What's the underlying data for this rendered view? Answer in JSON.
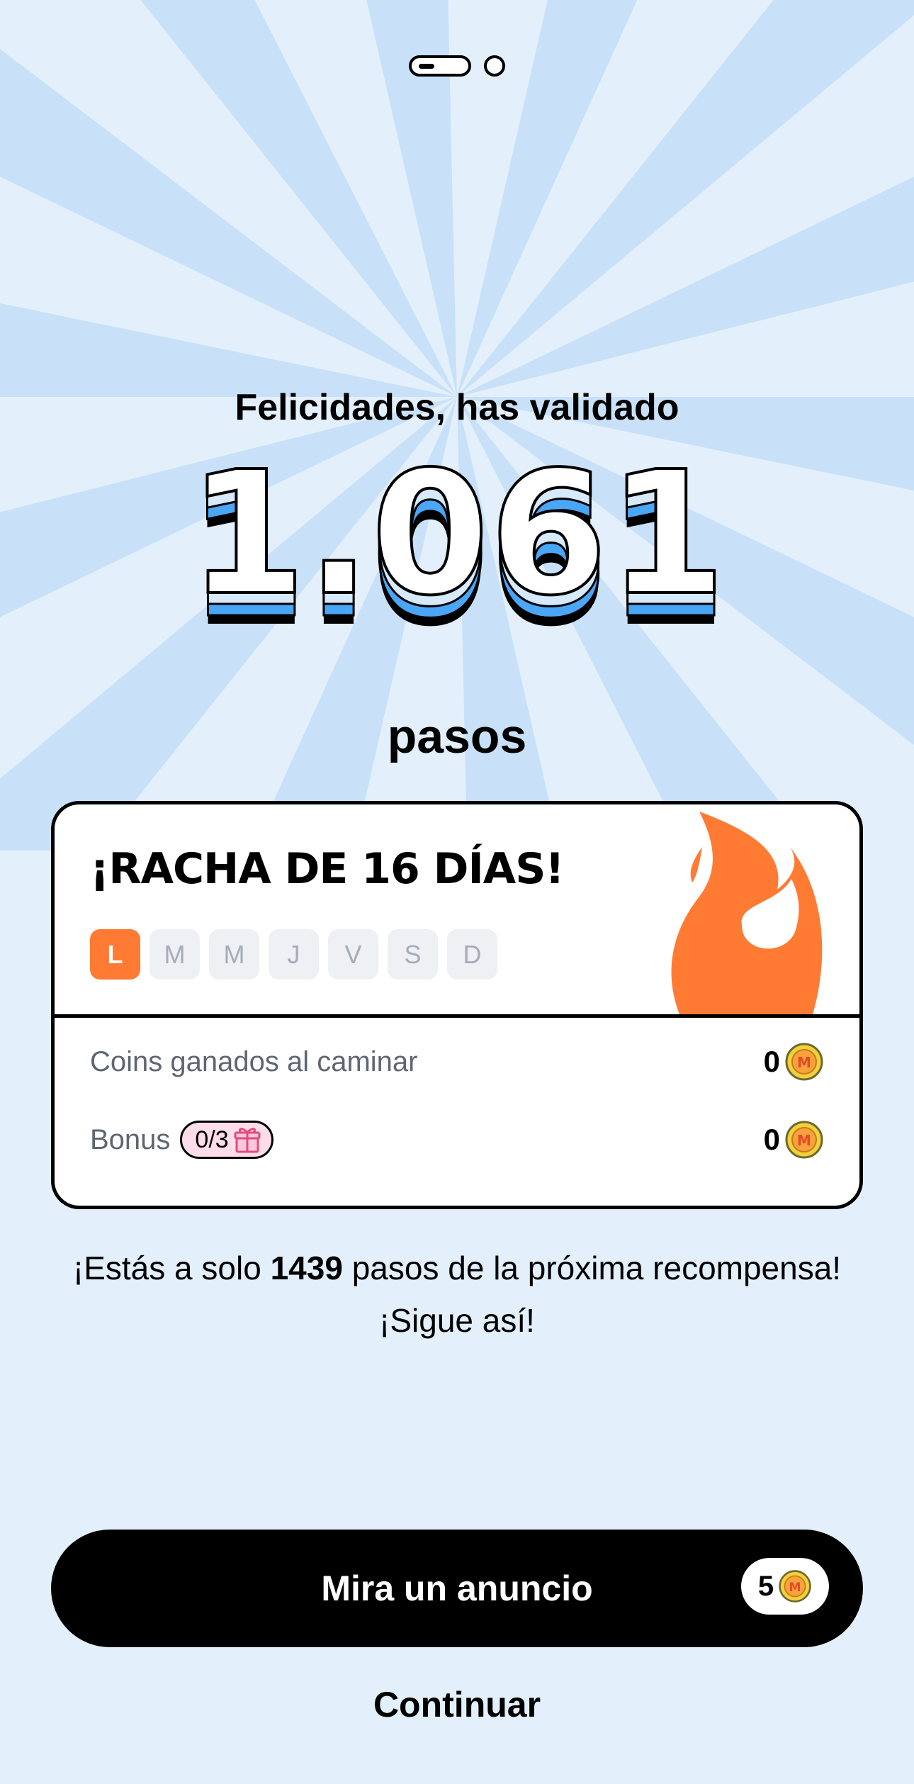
{
  "colors": {
    "background": "#e3f0fc",
    "rays": "#c9e1f8",
    "accent_orange": "#ff7a33",
    "accent_blue": "#4aa6f6",
    "coin_gold": "#f3cf3b",
    "badge_pink": "#ffdcea"
  },
  "pager": {
    "pages": 2,
    "current": 1
  },
  "header": {
    "congrats": "Felicidades, has validado",
    "steps": "1.061",
    "unit": "pasos"
  },
  "streak": {
    "title": "¡RACHA DE 16 DÍAS!",
    "days": [
      {
        "label": "L",
        "active": true
      },
      {
        "label": "M",
        "active": false
      },
      {
        "label": "M",
        "active": false
      },
      {
        "label": "J",
        "active": false
      },
      {
        "label": "V",
        "active": false
      },
      {
        "label": "S",
        "active": false
      },
      {
        "label": "D",
        "active": false
      }
    ],
    "icon": "flame-icon"
  },
  "earnings": {
    "walk_label": "Coins ganados al caminar",
    "walk_value": "0",
    "bonus_label": "Bonus",
    "bonus_badge": "0/3",
    "bonus_icon": "gift-icon",
    "bonus_value": "0",
    "coin_icon": "coin-icon"
  },
  "reward": {
    "prefix": "¡Estás a solo ",
    "steps_left": "1439",
    "suffix": " pasos de la próxima recompensa!",
    "cheer": "¡Sigue así!"
  },
  "actions": {
    "ad_label": "Mira un anuncio",
    "ad_reward": "5",
    "continue_label": "Continuar"
  }
}
